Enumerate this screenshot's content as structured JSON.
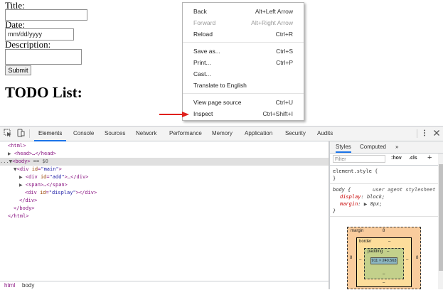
{
  "form": {
    "title_label": "Title:",
    "date_label": "Date:",
    "date_placeholder": "mm/dd/yyyy",
    "description_label": "Description:",
    "submit_label": "Submit",
    "heading": "TODO List:"
  },
  "context_menu": {
    "items": [
      {
        "label": "Back",
        "shortcut": "Alt+Left Arrow",
        "enabled": true
      },
      {
        "label": "Forward",
        "shortcut": "Alt+Right Arrow",
        "enabled": false
      },
      {
        "label": "Reload",
        "shortcut": "Ctrl+R",
        "enabled": true
      },
      {
        "label": "Save as...",
        "shortcut": "Ctrl+S",
        "enabled": true
      },
      {
        "label": "Print...",
        "shortcut": "Ctrl+P",
        "enabled": true
      },
      {
        "label": "Cast...",
        "shortcut": "",
        "enabled": true
      },
      {
        "label": "Translate to English",
        "shortcut": "",
        "enabled": true
      },
      {
        "label": "View page source",
        "shortcut": "Ctrl+U",
        "enabled": true
      },
      {
        "label": "Inspect",
        "shortcut": "Ctrl+Shift+I",
        "enabled": true
      }
    ]
  },
  "devtools": {
    "tabs": [
      "Elements",
      "Console",
      "Sources",
      "Network",
      "Performance",
      "Memory",
      "Application",
      "Security",
      "Audits"
    ],
    "active_tab": "Elements",
    "more_tabs": "»",
    "dom": {
      "html_open": "<html>",
      "head": "<head>…</head>",
      "body_open": "<body>",
      "body_eq": " == $0",
      "ellipsis": "...",
      "div_main_tag": "div",
      "div_main_attr": "id",
      "div_main_val": "\"main\"",
      "div_add_tag": "div",
      "div_add_attr": "id",
      "div_add_val": "\"add\"",
      "div_add_rest": ">…</div>",
      "span": "<span>…</span>",
      "div_display_tag": "div",
      "div_display_attr": "id",
      "div_display_val": "\"display\"",
      "div_display_rest": "></div>",
      "div_close": "</div>",
      "body_close": "</body>",
      "html_close": "</html>"
    },
    "breadcrumbs": [
      "html",
      "body"
    ],
    "styles": {
      "tabs": [
        "Styles",
        "Computed"
      ],
      "more": "»",
      "filter_placeholder": "Filter",
      "hov": ":hov",
      "cls": ".cls",
      "add": "+",
      "element_style": "element.style {",
      "close_brace": "}",
      "rule_selector": "body {",
      "rule_source": "user agent stylesheet",
      "prop1_name": "display",
      "prop1_value": "block;",
      "prop2_name": "margin",
      "prop2_value": "8px;",
      "box_model": {
        "margin_label": "margin",
        "margin_top": "8",
        "margin_left": "8",
        "margin_right": "8",
        "border_label": "border",
        "border_value": "–",
        "padding_label": "padding",
        "padding_value": "–",
        "content": "911 × 240.563",
        "dash": "–"
      }
    }
  },
  "colors": {
    "arrow": "#e0201c",
    "active_tab": "#1a73e8"
  }
}
